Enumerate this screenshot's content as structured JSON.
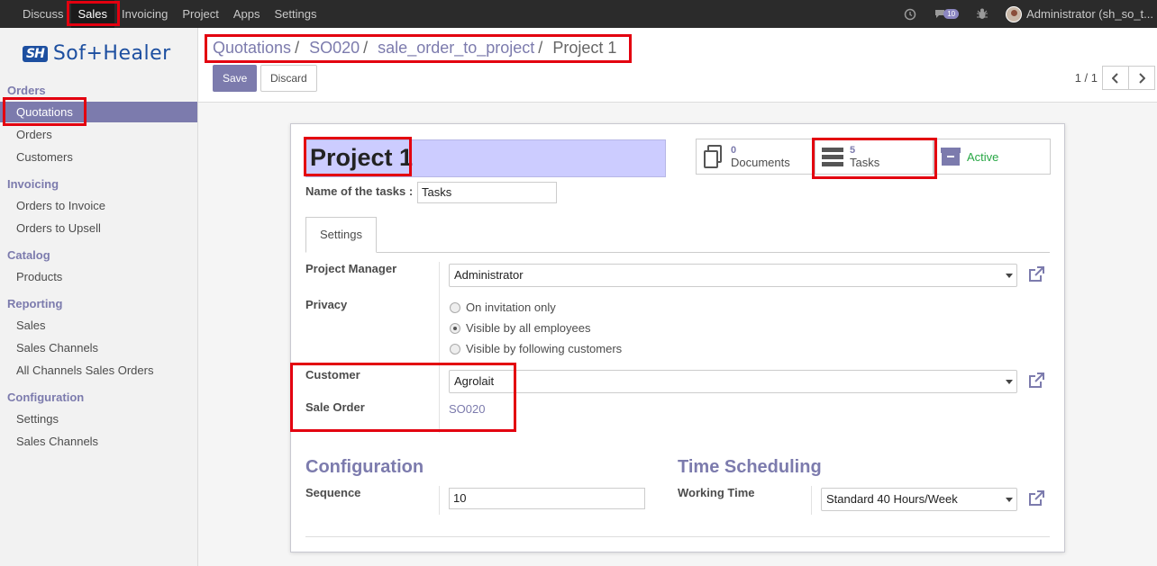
{
  "topbar": {
    "menu": [
      "Discuss",
      "Sales",
      "Invoicing",
      "Project",
      "Apps",
      "Settings"
    ],
    "active": "Sales",
    "message_count": "10",
    "user": "Administrator (sh_so_t..."
  },
  "sidebar": {
    "logo_mark": "SH",
    "logo_text": "Sof+Healer",
    "sections": [
      {
        "title": "Orders",
        "items": [
          "Quotations",
          "Orders",
          "Customers"
        ]
      },
      {
        "title": "Invoicing",
        "items": [
          "Orders to Invoice",
          "Orders to Upsell"
        ]
      },
      {
        "title": "Catalog",
        "items": [
          "Products"
        ]
      },
      {
        "title": "Reporting",
        "items": [
          "Sales",
          "Sales Channels",
          "All Channels Sales Orders"
        ]
      },
      {
        "title": "Configuration",
        "items": [
          "Settings",
          "Sales Channels"
        ]
      }
    ],
    "active_item": "Quotations"
  },
  "breadcrumb": [
    "Quotations",
    "SO020",
    "sale_order_to_project",
    "Project 1"
  ],
  "buttons": {
    "save": "Save",
    "discard": "Discard"
  },
  "pager": {
    "text": "1 / 1"
  },
  "form": {
    "title": "Project 1",
    "name_of_tasks_label": "Name of the tasks :",
    "name_of_tasks_value": "Tasks",
    "smart_buttons": {
      "documents": {
        "value": "0",
        "label": "Documents"
      },
      "tasks": {
        "value": "5",
        "label": "Tasks"
      },
      "active": {
        "label": "Active"
      }
    },
    "tab": "Settings",
    "project_manager_label": "Project Manager",
    "project_manager_value": "Administrator",
    "privacy_label": "Privacy",
    "privacy_options": [
      "On invitation only",
      "Visible by all employees",
      "Visible by following customers"
    ],
    "privacy_selected": "Visible by all employees",
    "customer_label": "Customer",
    "customer_value": "Agrolait",
    "sale_order_label": "Sale Order",
    "sale_order_value": "SO020",
    "configuration_title": "Configuration",
    "sequence_label": "Sequence",
    "sequence_value": "10",
    "time_scheduling_title": "Time Scheduling",
    "working_time_label": "Working Time",
    "working_time_value": "Standard 40 Hours/Week"
  },
  "colors": {
    "accent": "#7c7bad",
    "highlight": "#e3000f",
    "title_bg": "#ccccff",
    "active_green": "#28a745"
  }
}
